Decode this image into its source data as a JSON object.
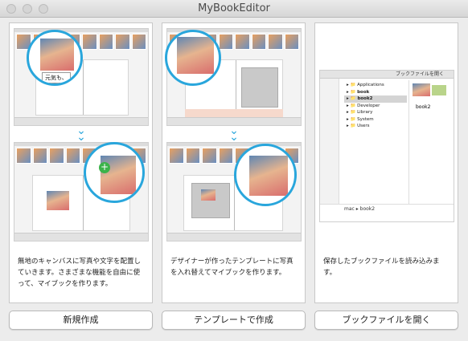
{
  "window": {
    "title": "MyBookEditor"
  },
  "panels": [
    {
      "id": "new",
      "zoom_caption": "元気も、",
      "description": "無地のキャンバスに写真や文字を配置していきます。さまざまな機能を自由に使って、マイブックを作ります。",
      "button_label": "新規作成"
    },
    {
      "id": "template",
      "description": "デザイナーが作ったテンプレートに写真を入れ替えてマイブックを作ります。",
      "button_label": "テンプレートで作成"
    },
    {
      "id": "open",
      "finder": {
        "title": "ブックファイルを開く",
        "items": [
          "Applications",
          "book",
          "book2",
          "Developer",
          "Library",
          "System",
          "Users"
        ],
        "selected": "book2",
        "preview_name": "book2",
        "path": [
          "mac",
          "book2"
        ]
      },
      "description": "保存したブックファイルを読み込みます。",
      "button_label": "ブックファイルを開く"
    }
  ],
  "colors": {
    "accent": "#29a6dc"
  }
}
